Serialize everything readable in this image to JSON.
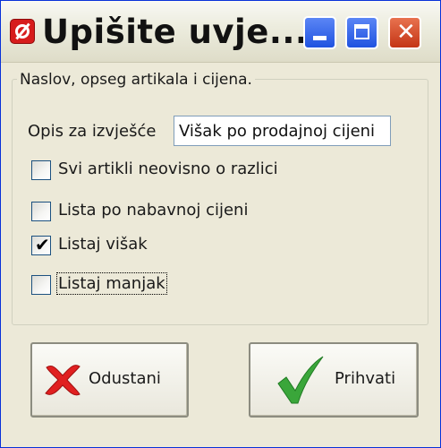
{
  "window": {
    "title": "Upišite uvje...",
    "icon": "app-no-entry-icon"
  },
  "titlebar_buttons": {
    "minimize": "minimize-icon",
    "maximize": "maximize-icon",
    "close": "close-icon"
  },
  "group": {
    "caption": "Naslov, opseg artikala i cijena."
  },
  "report": {
    "label": "Opis za izvješće",
    "value": "Višak po prodajnoj cijeni"
  },
  "options": [
    {
      "label": "Svi artikli neovisno o razlici",
      "checked": false
    },
    {
      "label": "Lista po nabavnoj cijeni",
      "checked": false
    },
    {
      "label": "Listaj višak",
      "checked": true
    },
    {
      "label": "Listaj manjak",
      "checked": false
    }
  ],
  "buttons": {
    "cancel": {
      "label": "Odustani",
      "icon": "red-x-icon"
    },
    "accept": {
      "label": "Prihvati",
      "icon": "green-checkmark-icon"
    }
  },
  "colors": {
    "window_border": "#0831d9",
    "close_button": "#c43515",
    "cancel_icon": "#e02020",
    "accept_icon": "#3aa63a"
  }
}
